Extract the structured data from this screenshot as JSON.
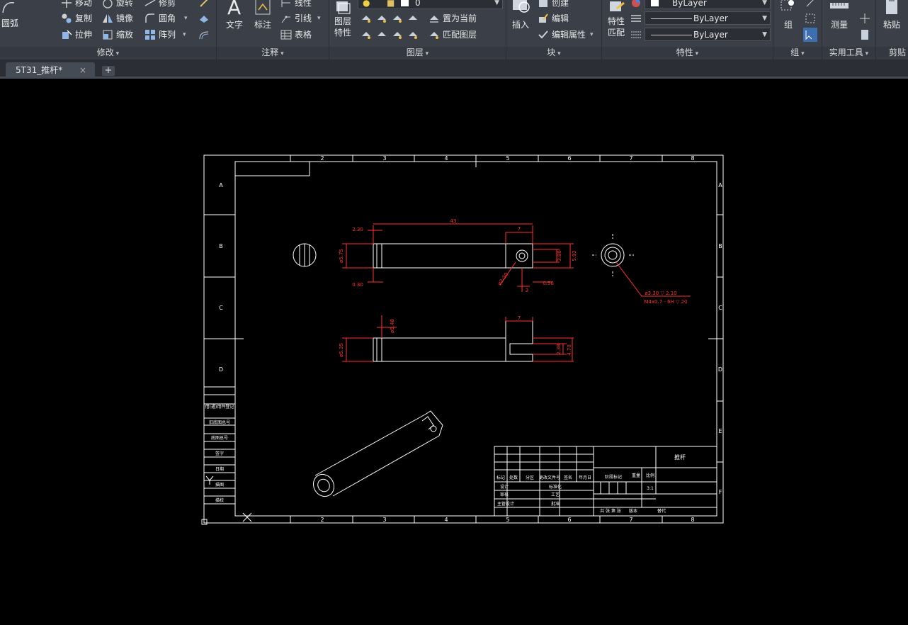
{
  "ribbon": {
    "modify": {
      "label": "修改",
      "buttons": [
        "移动",
        "旋转",
        "修剪",
        "复制",
        "镜像",
        "圆角",
        "拉伸",
        "缩放",
        "阵列"
      ],
      "arc_label": "圆弧"
    },
    "annotation": {
      "label": "注释",
      "text_btn": "文字",
      "dim_btn": "标注",
      "linear_btn": "线性",
      "leader_btn": "引线",
      "table_btn": "表格"
    },
    "layers": {
      "label": "图层",
      "layer_props_line1": "图层",
      "layer_props_line2": "特性",
      "current_layer": "0",
      "set_current_btn": "置为当前",
      "match_layer_btn": "匹配图层"
    },
    "block": {
      "label": "块",
      "insert_btn": "插入",
      "create_btn": "创建",
      "edit_btn": "编辑",
      "edit_attr_btn": "编辑属性"
    },
    "properties": {
      "label": "特性",
      "match_line1": "特性",
      "match_line2": "匹配",
      "color_value": "ByLayer",
      "linetype_value": "ByLayer",
      "lineweight_value": "ByLayer"
    },
    "groups": {
      "label": "组",
      "group_btn": "组"
    },
    "utilities": {
      "label": "实用工具",
      "measure_btn": "测量"
    },
    "clipboard": {
      "label": "剪贴",
      "paste_btn": "粘贴"
    }
  },
  "tabs": {
    "file_tab": "5T31_推杆*",
    "close_glyph": "×",
    "add_glyph": "+"
  },
  "drawing": {
    "border_cols": [
      "2",
      "3",
      "4",
      "5",
      "6",
      "7",
      "8"
    ],
    "border_rows": [
      "A",
      "B",
      "C",
      "D",
      "E",
      "F"
    ],
    "dims": {
      "d_43": "43",
      "d_7a": "7",
      "d_230": "2.30",
      "d_030": "0.30",
      "d_575": "ø5.75",
      "d_380": "3.80",
      "d_592": "5.92",
      "d_r20": "ø2.30",
      "d_3": "3",
      "d_050": "0.50",
      "d_7b": "7",
      "d_548": "ø5.48",
      "d_535": "ø5.35",
      "d_238": "2.38",
      "d_470": "4.70",
      "hole_note1": "ø3.30 ▽ 2.10",
      "hole_note2": "M4x0.7 - 6H ▽ 20"
    },
    "title_block": {
      "part_name": "推杆",
      "scale": "3:1",
      "c_mark": "标记",
      "c_count": "处数",
      "c_zone": "分区",
      "c_docno": "更改文件号",
      "c_sign": "签名",
      "c_date": "年月日",
      "c_stage": "阶段标记",
      "c_weight": "重量",
      "c_ratio": "比例",
      "c_design": "设计",
      "c_std": "标准化",
      "c_check": "审核",
      "c_process": "工艺",
      "c_manager": "主管设计",
      "c_approve": "批准",
      "c_sheets": "共 张 第 张",
      "c_version": "版本",
      "c_replace": "替代"
    },
    "side_table": [
      "借(通)用件登记",
      "旧底图总号",
      "底图总号",
      "签字",
      "日期",
      "描图",
      "描校",
      "签字",
      "日期"
    ]
  }
}
